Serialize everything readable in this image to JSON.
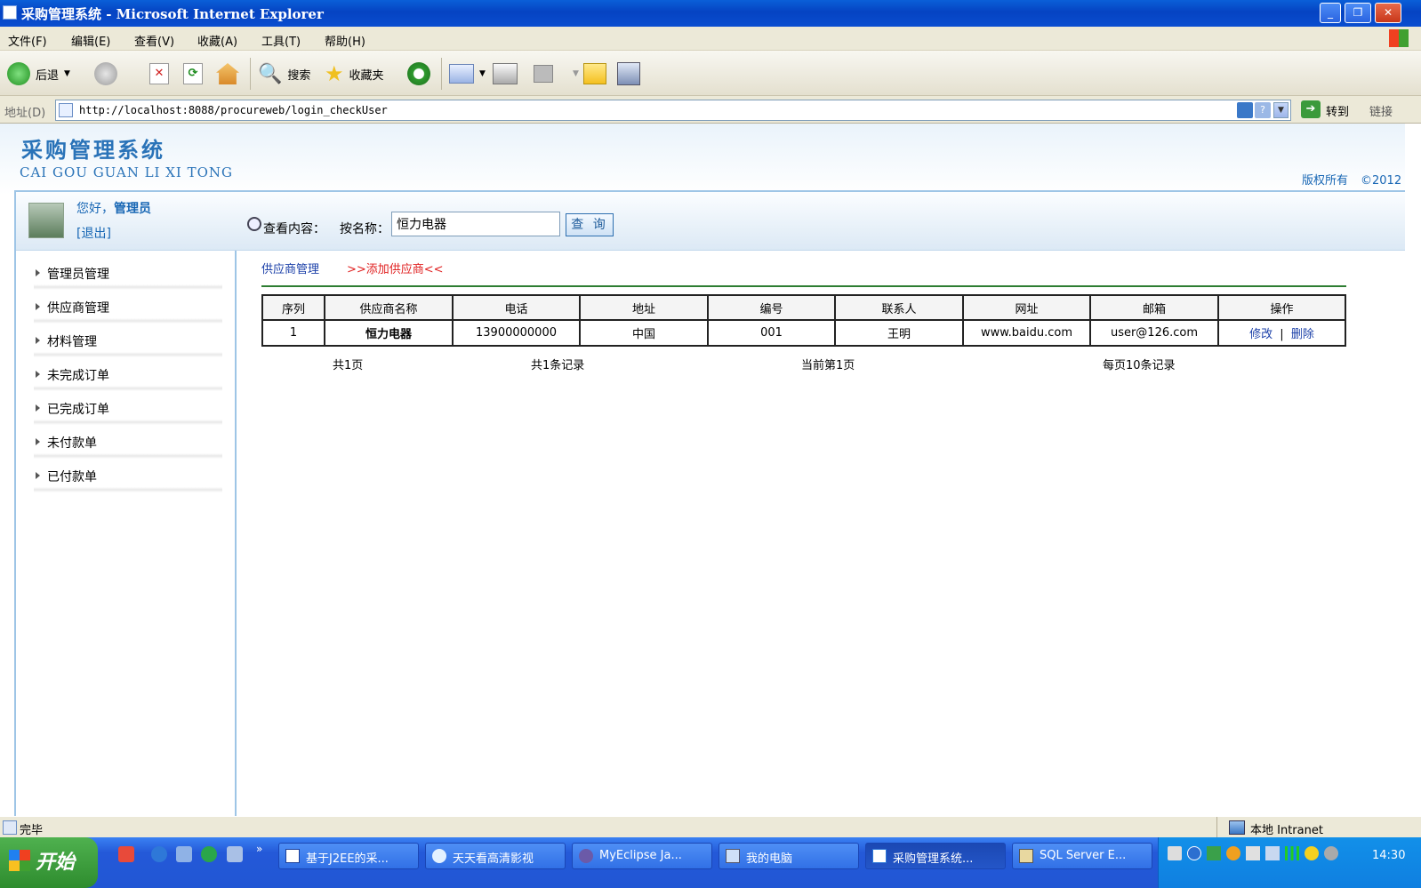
{
  "window": {
    "title": "采购管理系统 - Microsoft Internet Explorer",
    "min_btn": "_",
    "close_btn": "✕"
  },
  "menu": [
    "文件(F)",
    "编辑(E)",
    "查看(V)",
    "收藏(A)",
    "工具(T)",
    "帮助(H)"
  ],
  "toolbar": {
    "back": "后退",
    "search": "搜索",
    "favorites": "收藏夹"
  },
  "address": {
    "label": "地址(D)",
    "url": "http://localhost:8088/procureweb/login_checkUser",
    "go": "转到",
    "links": "链接"
  },
  "site": {
    "title_cn": "采购管理系统",
    "title_en": "CAI GOU GUAN LI XI TONG",
    "copyright": "版权所有",
    "year": "©2012"
  },
  "user": {
    "greeting": "您好，",
    "name": "管理员",
    "logout": "[退出]"
  },
  "nav": [
    "管理员管理",
    "供应商管理",
    "材料管理",
    "未完成订单",
    "已完成订单",
    "未付款单",
    "已付款单"
  ],
  "search": {
    "label": "查看内容：",
    "field_label": "按名称：",
    "value": "恒力电器",
    "button": "查 询"
  },
  "breadcrumb": {
    "current": "供应商管理",
    "add_link": ">>添加供应商<<"
  },
  "table": {
    "headers": [
      "序列",
      "供应商名称",
      "电话",
      "地址",
      "编号",
      "联系人",
      "网址",
      "邮箱",
      "操作"
    ],
    "rows": [
      {
        "seq": "1",
        "name": "恒力电器",
        "phone": "13900000000",
        "address": "中国",
        "code": "001",
        "contact": "王明",
        "website": "www.baidu.com",
        "email": "user@126.com",
        "edit": "修改",
        "sep": "|",
        "delete": "删除"
      }
    ]
  },
  "pager": {
    "total_pages": "共1页",
    "total_records": "共1条记录",
    "current_page": "当前第1页",
    "per_page": "每页10条记录"
  },
  "status": {
    "text": "完毕",
    "zone": "本地 Intranet"
  },
  "taskbar": {
    "start": "开始",
    "tasks": [
      "基于J2EE的采...",
      "天天看高清影视",
      "MyEclipse Ja...",
      "我的电脑",
      "采购管理系统...",
      "SQL Server E..."
    ],
    "clock": "14:30"
  }
}
